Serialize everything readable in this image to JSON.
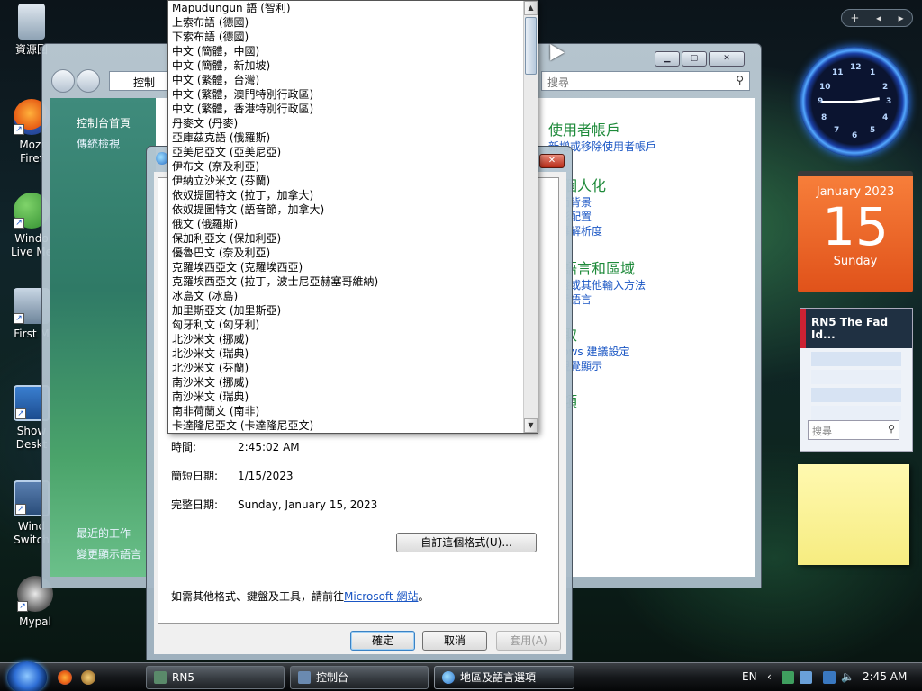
{
  "desktop": {
    "icons": [
      {
        "label": "資源回"
      },
      {
        "label": "Mozi",
        "label2": "Firef"
      },
      {
        "label": "Windo",
        "label2": "Live Me"
      },
      {
        "label": "First M"
      },
      {
        "label": "Show",
        "label2": "Deskt"
      },
      {
        "label": "Wind",
        "label2": "Switch"
      },
      {
        "label": "Mypal"
      }
    ]
  },
  "gadgets": {
    "sidebar_controls": {
      "add": "+",
      "prev": "◂",
      "next": "▸"
    },
    "clock": {
      "numbers": [
        "12",
        "1",
        "2",
        "3",
        "4",
        "5",
        "6",
        "7",
        "8",
        "9",
        "10",
        "11"
      ]
    },
    "calendar": {
      "month": "January 2023",
      "day": "15",
      "weekday": "Sunday"
    },
    "feed": {
      "title": "RN5 The Fad Id...",
      "search_placeholder": "搜尋"
    }
  },
  "control_panel": {
    "address": "控制",
    "search_placeholder": "搜尋",
    "left_nav": {
      "home": "控制台首頁",
      "classic": "傳統檢視",
      "recent_tasks": "最近的工作",
      "change_display_language": "變更顯示語言"
    },
    "categories": [
      {
        "title": "使用者帳戶",
        "links": [
          "新增或移除使用者帳戶"
        ]
      },
      {
        "title": "及個人化",
        "links": [
          "桌面背景",
          "色彩配置",
          "螢幕解析度"
        ]
      },
      {
        "title": "、語言和區域",
        "links": [
          "鍵盤或其他輸入方法",
          "顯示語言"
        ]
      },
      {
        "title": "存取",
        "links": [
          "ndows 建議設定",
          "化視覺顯示"
        ]
      },
      {
        "title": "選項",
        "links": []
      }
    ]
  },
  "region_dialog": {
    "formats": {
      "time_label": "時間:",
      "time_value": "2:45:02 AM",
      "short_date_label": "簡短日期:",
      "short_date_value": "1/15/2023",
      "long_date_label": "完整日期:",
      "long_date_value": "Sunday, January 15, 2023"
    },
    "customize_button": "自訂這個格式(U)...",
    "more_info_prefix": "如需其他格式、鍵盤及工具，請前往",
    "more_info_link": "Microsoft 網站",
    "more_info_suffix": "。",
    "ok_button": "確定",
    "cancel_button": "取消",
    "apply_button": "套用(A)"
  },
  "language_dropdown": {
    "items": [
      "Mapudungun 語 (智利)",
      "上索布語 (德國)",
      "下索布語 (德國)",
      "中文 (簡體，中國)",
      "中文 (簡體，新加坡)",
      "中文 (繁體，台灣)",
      "中文 (繁體，澳門特別行政區)",
      "中文 (繁體，香港特別行政區)",
      "丹麥文 (丹麥)",
      "亞庫茲克語 (俄羅斯)",
      "亞美尼亞文 (亞美尼亞)",
      "伊布文 (奈及利亞)",
      "伊納立沙米文 (芬蘭)",
      "依奴提圖特文 (拉丁，加拿大)",
      "依奴提圖特文 (語音節，加拿大)",
      "俄文 (俄羅斯)",
      "保加利亞文 (保加利亞)",
      "優魯巴文 (奈及利亞)",
      "克羅埃西亞文 (克羅埃西亞)",
      "克羅埃西亞文 (拉丁，波士尼亞赫塞哥維納)",
      "冰島文 (冰島)",
      "加里斯亞文 (加里斯亞)",
      "匈牙利文 (匈牙利)",
      "北沙米文 (挪威)",
      "北沙米文 (瑞典)",
      "北沙米文 (芬蘭)",
      "南沙米文 (挪威)",
      "南沙米文 (瑞典)",
      "南非荷蘭文 (南非)",
      "卡達隆尼亞文 (卡達隆尼亞文)"
    ]
  },
  "taskbar": {
    "tasks": [
      {
        "label": "RN5"
      },
      {
        "label": "控制台"
      },
      {
        "label": "地區及語言選項"
      }
    ],
    "language": "EN",
    "time": "2:45 AM"
  },
  "colors": {
    "link": "#1a56c4",
    "category_title": "#1e8a3a",
    "calendar": "#f26a2a"
  }
}
